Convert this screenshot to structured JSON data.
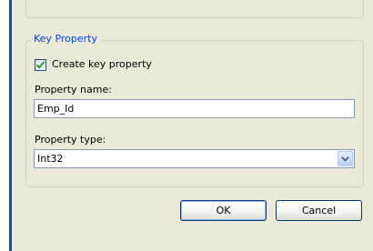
{
  "key_property": {
    "group_title": "Key Property",
    "create_checkbox": {
      "label": "Create key property",
      "checked": true
    },
    "property_name": {
      "label": "Property name:",
      "value": "Emp_Id"
    },
    "property_type": {
      "label": "Property type:",
      "selected": "Int32"
    }
  },
  "buttons": {
    "ok_label": "OK",
    "cancel_label": "Cancel"
  }
}
